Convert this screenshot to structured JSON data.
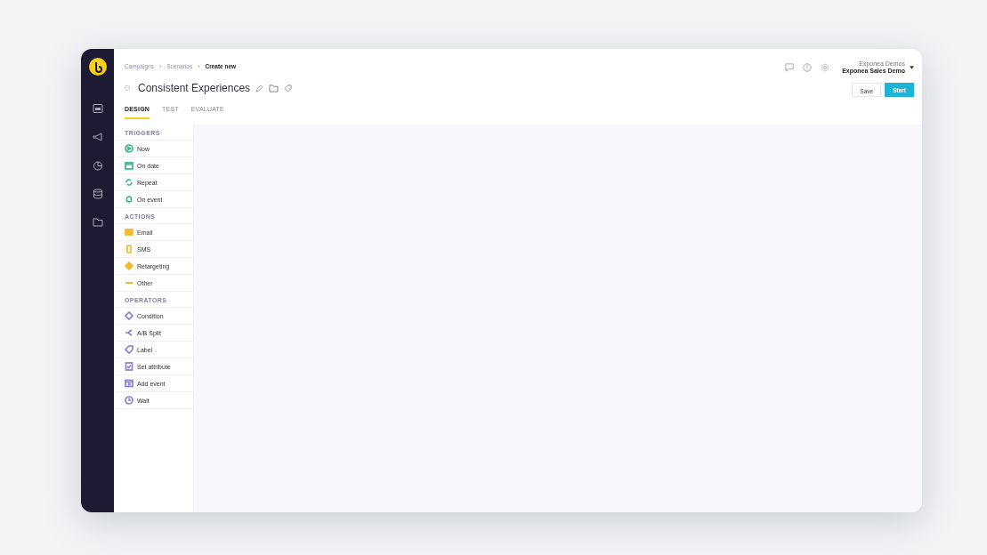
{
  "breadcrumbs": [
    {
      "label": "Campaigns",
      "current": false
    },
    {
      "label": "Scenarios",
      "current": false
    },
    {
      "label": "Create new",
      "current": true
    }
  ],
  "breadcrumb_separator": "›",
  "title": "Consistent Experiences",
  "account": {
    "org": "Exponea Demos",
    "project": "Exponea Sales Demo"
  },
  "buttons": [
    {
      "label": "Save",
      "kind": "secondary"
    },
    {
      "label": "Start",
      "kind": "primary"
    }
  ],
  "tabs": [
    {
      "label": "DESIGN",
      "selected": true
    },
    {
      "label": "TEST",
      "selected": false
    },
    {
      "label": "EVALUATE",
      "selected": false
    }
  ],
  "sections": [
    {
      "title": "TRIGGERS",
      "color": "#3cb68f",
      "items": [
        {
          "label": "Now",
          "kind": "play"
        },
        {
          "label": "On date",
          "kind": "calendar"
        },
        {
          "label": "Repeat",
          "kind": "repeat"
        },
        {
          "label": "On event",
          "kind": "bell"
        }
      ]
    },
    {
      "title": "ACTIONS",
      "color": "#f5b82e",
      "items": [
        {
          "label": "Email",
          "kind": "mail"
        },
        {
          "label": "SMS",
          "kind": "phone"
        },
        {
          "label": "Retargeting",
          "kind": "diamond"
        },
        {
          "label": "Other",
          "kind": "dash"
        }
      ]
    },
    {
      "title": "OPERATORS",
      "color": "#8a7fd6",
      "items": [
        {
          "label": "Condition",
          "kind": "outline-diamond"
        },
        {
          "label": "A/B Split",
          "kind": "split"
        },
        {
          "label": "Label",
          "kind": "tag"
        },
        {
          "label": "Set attribute",
          "kind": "check"
        },
        {
          "label": "Add event",
          "kind": "add-event"
        },
        {
          "label": "Wait",
          "kind": "clock"
        }
      ]
    }
  ]
}
